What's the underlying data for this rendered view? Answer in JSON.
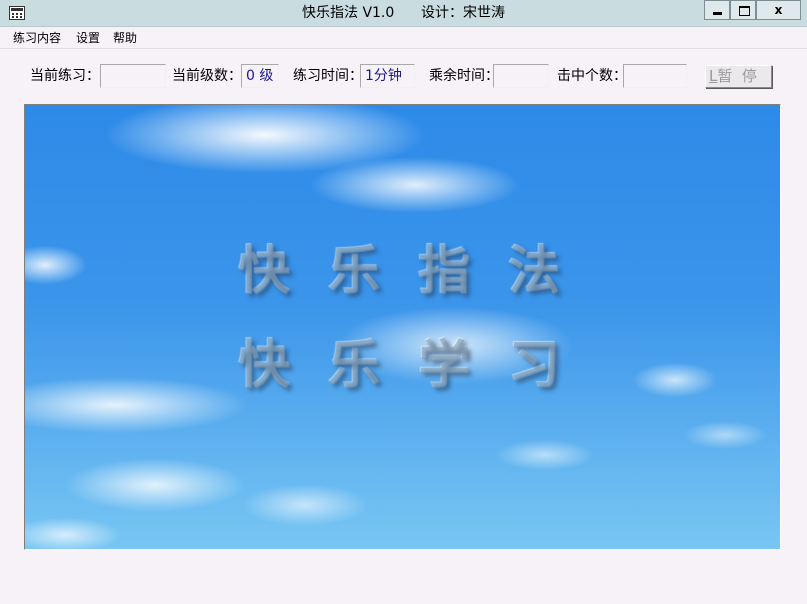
{
  "window": {
    "title_app": "快乐指法 V1.0",
    "title_design": "设计：宋世涛",
    "icon": "calculator-icon",
    "min_icon": "minimize-icon",
    "max_icon": "maximize-icon",
    "close_label": "x"
  },
  "menu": {
    "items": [
      "练习内容",
      "设置",
      "帮助"
    ]
  },
  "toolbar": {
    "current_practice_label": "当前练习：",
    "current_practice_value": "",
    "current_level_label": "当前级数：",
    "current_level_value": "0 级",
    "practice_time_label": "练习时间：",
    "practice_time_value": "1分钟",
    "remaining_time_label": "乘余时间：",
    "remaining_time_value": "",
    "hit_count_label": "击中个数：",
    "hit_count_value": "",
    "pause_key": "L",
    "pause_label": "暂  停"
  },
  "panel": {
    "line1": "快乐指法",
    "line2": "快乐学习"
  }
}
